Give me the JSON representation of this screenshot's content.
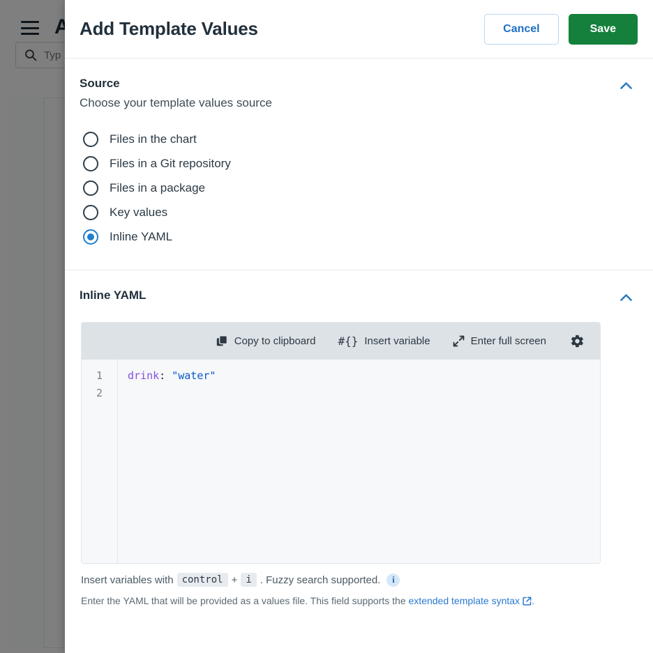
{
  "background": {
    "menu_icon": "hamburger-menu-icon",
    "logo_text": "A",
    "search": {
      "icon": "search-icon",
      "value": "Typ"
    }
  },
  "drawer": {
    "title": "Add Template Values",
    "cancel_label": "Cancel",
    "save_label": "Save",
    "source_section": {
      "title": "Source",
      "subtitle": "Choose your template values source",
      "collapse_icon": "chevron-up-icon",
      "options": [
        {
          "label": "Files in the chart",
          "selected": false
        },
        {
          "label": "Files in a Git repository",
          "selected": false
        },
        {
          "label": "Files in a package",
          "selected": false
        },
        {
          "label": "Key values",
          "selected": false
        },
        {
          "label": "Inline YAML",
          "selected": true
        }
      ]
    },
    "yaml_section": {
      "title": "Inline YAML",
      "collapse_icon": "chevron-up-icon",
      "toolbar": {
        "copy_label": "Copy to clipboard",
        "copy_icon": "copy-icon",
        "insert_variable_label": "Insert variable",
        "insert_variable_icon": "#{}",
        "fullscreen_label": "Enter full screen",
        "fullscreen_icon": "expand-arrows-icon",
        "settings_icon": "gear-icon"
      },
      "editor": {
        "line_numbers": [
          "1",
          "2"
        ],
        "code_key": "drink",
        "code_colon": ":",
        "code_value": "\"water\""
      },
      "hint": {
        "prefix": "Insert variables with",
        "key1": "control",
        "plus": "+",
        "key2": "i",
        "suffix": ". Fuzzy search supported.",
        "info_icon": "i"
      },
      "help": {
        "text": "Enter the YAML that will be provided as a values file. This field supports the",
        "link_text": "extended template syntax",
        "link_icon": "external-link-icon",
        "period": "."
      }
    }
  },
  "colors": {
    "accent_blue": "#1e7fd0",
    "save_green": "#15803c",
    "link_blue": "#2979d2"
  }
}
